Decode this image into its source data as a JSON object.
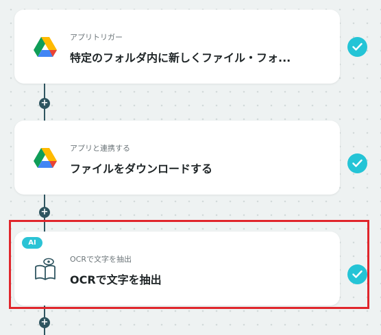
{
  "steps": [
    {
      "subtitle": "アプリトリガー",
      "title": "特定のフォルダ内に新しくファイル・フォ...",
      "icon": "google-drive-icon"
    },
    {
      "subtitle": "アプリと連携する",
      "title": "ファイルをダウンロードする",
      "icon": "google-drive-icon"
    },
    {
      "subtitle": "OCRで文字を抽出",
      "title": "OCRで文字を抽出",
      "icon": "ocr-book-icon",
      "badge": "AI"
    }
  ],
  "add_button_label": "+",
  "colors": {
    "accent": "#24c4d6",
    "line": "#2f5560",
    "highlight": "#e0252b"
  }
}
